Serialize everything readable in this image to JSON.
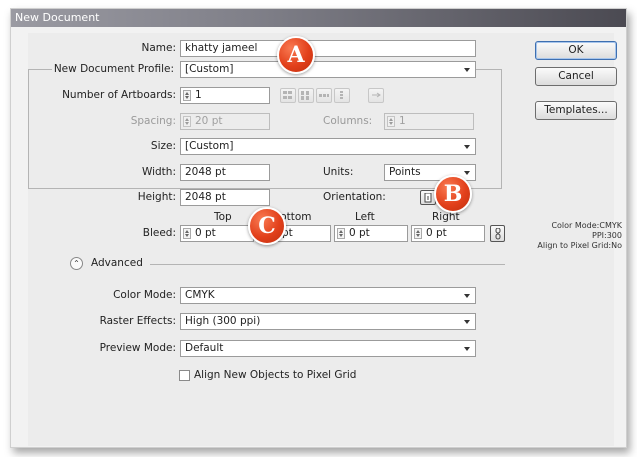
{
  "window": {
    "title": "New Document"
  },
  "form": {
    "name_label": "Name:",
    "name_value": "khatty jameel",
    "profile_label": "New Document Profile:",
    "profile_value": "[Custom]",
    "artboards_label": "Number of Artboards:",
    "artboards_value": "1",
    "spacing_label": "Spacing:",
    "spacing_value": "20 pt",
    "columns_label": "Columns:",
    "columns_value": "1",
    "size_label": "Size:",
    "size_value": "[Custom]",
    "width_label": "Width:",
    "width_value": "2048 pt",
    "units_label": "Units:",
    "units_value": "Points",
    "height_label": "Height:",
    "height_value": "2048 pt",
    "orientation_label": "Orientation:",
    "bleed_label": "Bleed:",
    "bleed_headers": {
      "top": "Top",
      "bottom": "Bottom",
      "left": "Left",
      "right": "Right"
    },
    "bleed_values": {
      "top": "0 pt",
      "bottom": "0 pt",
      "left": "0 pt",
      "right": "0 pt"
    },
    "advanced_label": "Advanced",
    "color_mode_label": "Color Mode:",
    "color_mode_value": "CMYK",
    "raster_label": "Raster Effects:",
    "raster_value": "High (300 ppi)",
    "preview_label": "Preview Mode:",
    "preview_value": "Default",
    "align_label": "Align New Objects to Pixel Grid",
    "align_checked": false
  },
  "buttons": {
    "ok": "OK",
    "cancel": "Cancel",
    "templates": "Templates..."
  },
  "summary": {
    "line1": "Color Mode:CMYK",
    "line2": "PPI:300",
    "line3": "Align to Pixel Grid:No"
  },
  "annotations": {
    "a": "A",
    "b": "B",
    "c": "C"
  },
  "colors": {
    "badge": "#e2401b",
    "default_button_border": "#3e6fb0"
  },
  "icons": [
    "spin-arrows-icon",
    "grid-by-row-icon",
    "grid-by-column-icon",
    "arrange-by-row-icon",
    "arrange-by-column-icon",
    "right-to-left-icon",
    "portrait-icon",
    "landscape-icon",
    "link-icon",
    "chevron-up-circle-icon",
    "dropdown-arrow-icon"
  ]
}
